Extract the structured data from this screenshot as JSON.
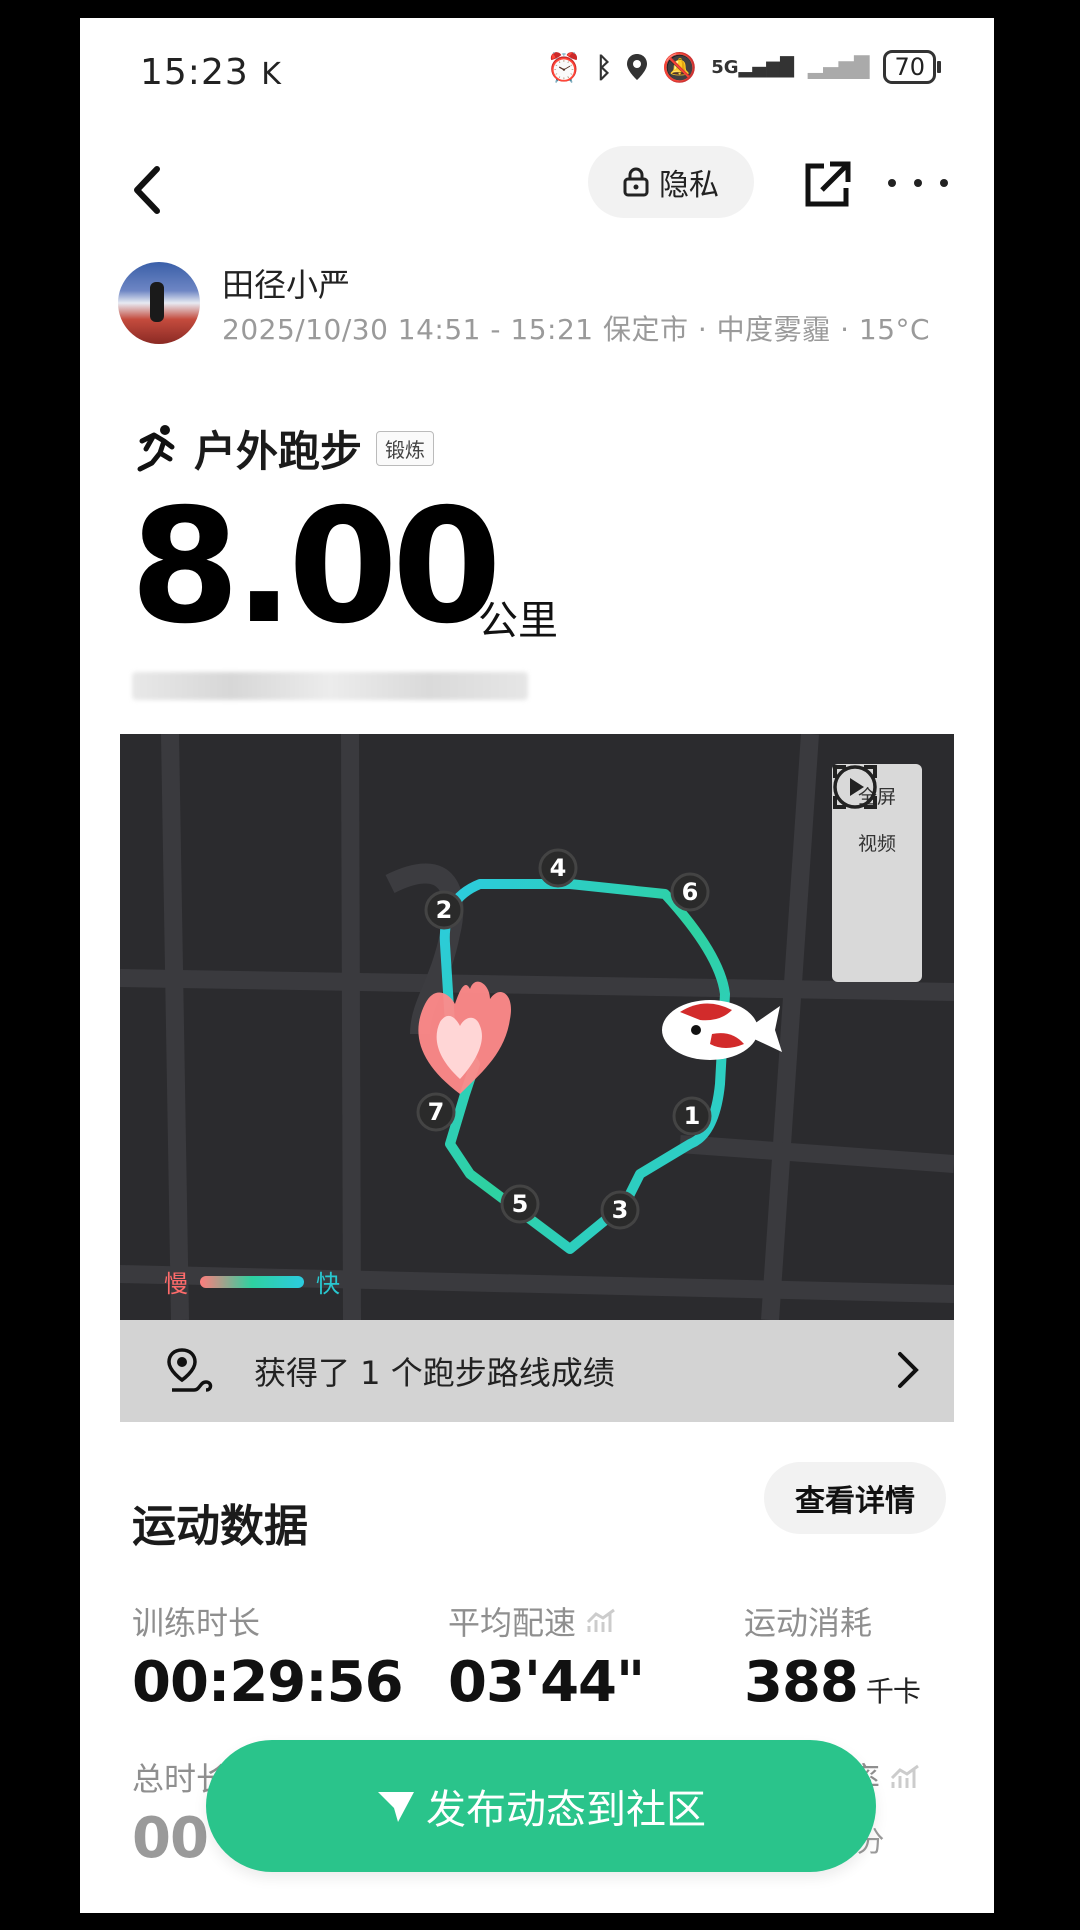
{
  "status_bar": {
    "time": "15:23",
    "k_indicator": "K",
    "network": "5G",
    "battery": "70"
  },
  "header": {
    "privacy_label": "隐私"
  },
  "user": {
    "name": "田径小严",
    "meta": "2025/10/30 14:51 - 15:21 保定市 · 中度雾霾 · 15°C"
  },
  "workout": {
    "type": "户外跑步",
    "tag": "锻炼",
    "distance": "8.00",
    "distance_unit": "公里"
  },
  "map": {
    "fullscreen_label": "全屏",
    "video_label": "视频",
    "legend_slow": "慢",
    "legend_fast": "快",
    "markers": [
      "1",
      "2",
      "3",
      "4",
      "5",
      "6",
      "7"
    ]
  },
  "achievement": {
    "text": "获得了 1 个跑步路线成绩"
  },
  "stats": {
    "section_title": "运动数据",
    "detail_button": "查看详情",
    "training_duration_label": "训练时长",
    "training_duration_value": "00:29:56",
    "avg_pace_label": "平均配速",
    "avg_pace_value": "03'44\"",
    "calories_label": "运动消耗",
    "calories_value": "388",
    "calories_unit": "千卡",
    "total_duration_label_partial": "总时长",
    "total_duration_value_partial": "00",
    "heart_rate_label_partial": "率",
    "heart_rate_unit_partial": "/分"
  },
  "cta": {
    "label": "发布动态到社区"
  },
  "colors": {
    "accent_green": "#2ac48b",
    "route_fast": "#2ccbe0",
    "route_slow": "#ff7d7d"
  }
}
